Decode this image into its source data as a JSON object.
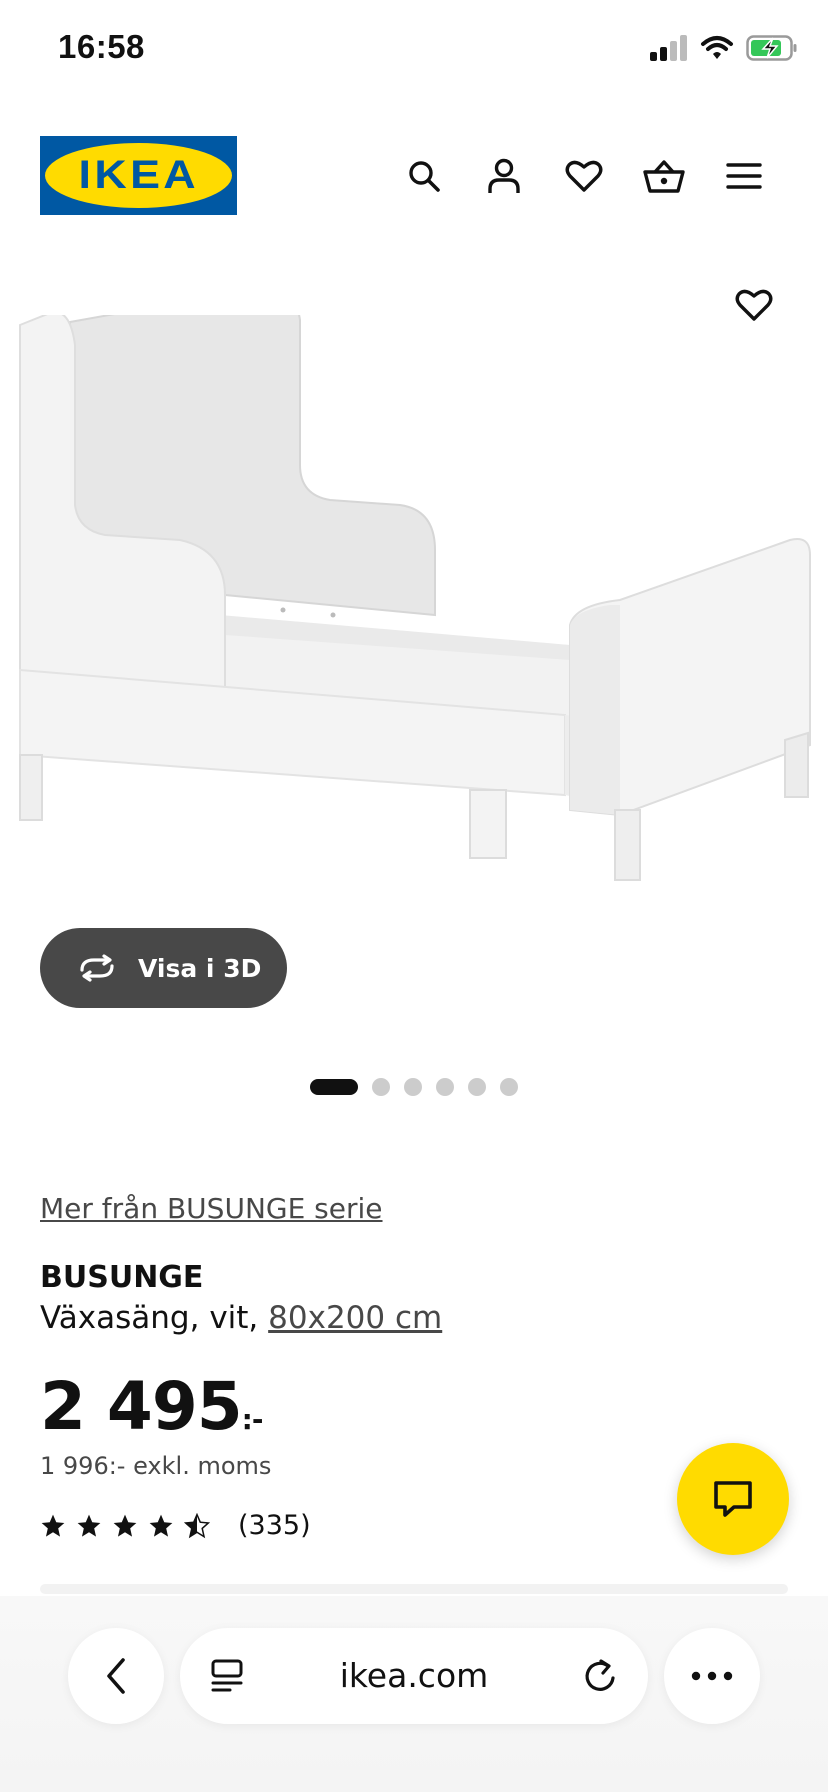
{
  "status_bar": {
    "time": "16:58"
  },
  "brand": {
    "logo_text": "IKEA",
    "blue": "#0058a3",
    "yellow": "#ffdb00"
  },
  "header": {
    "icons": [
      "search-icon",
      "account-icon",
      "heart-icon",
      "basket-icon",
      "menu-icon"
    ]
  },
  "gallery": {
    "view_3d_label": "Visa i 3D",
    "image_count": 6,
    "active_index": 0
  },
  "product": {
    "series_link": "Mer från BUSUNGE serie",
    "name": "BUSUNGE",
    "description_prefix": "Växasäng, vit,",
    "size_link": "80x200 cm",
    "price_main": "2 495",
    "price_suffix": ":-",
    "price_excl_vat": "1 996:- exkl. moms",
    "rating": 4.5,
    "rating_max": 5,
    "review_count": "(335)"
  },
  "browser": {
    "url": "ikea.com"
  }
}
